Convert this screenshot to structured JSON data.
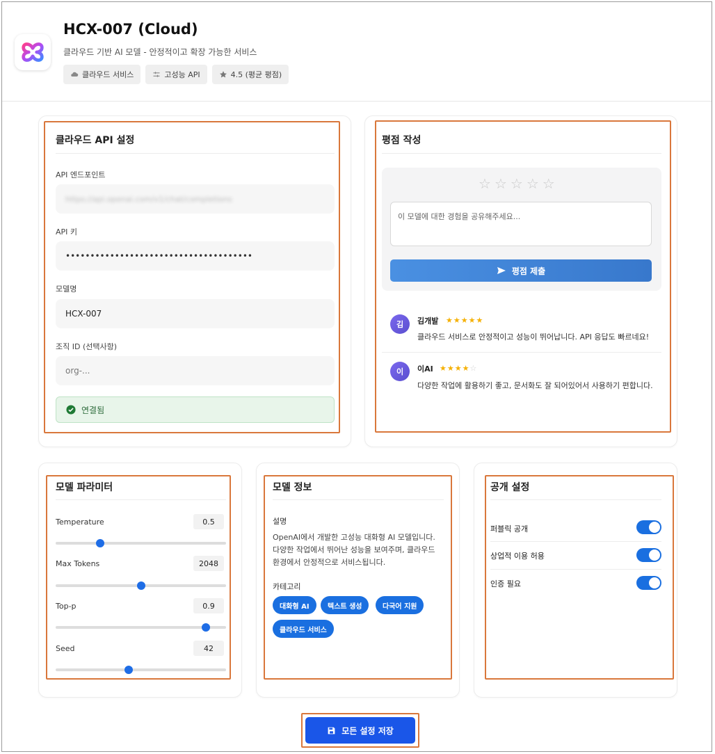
{
  "header": {
    "title": "HCX-007 (Cloud)",
    "subtitle": "클라우드 기반 AI 모델 - 안정적이고 확장 가능한 서비스",
    "badges": [
      {
        "icon": "cloud-icon",
        "label": "클라우드 서비스"
      },
      {
        "icon": "sliders-icon",
        "label": "고성능 API"
      },
      {
        "icon": "star-icon",
        "label": "4.5 (평균 평점)"
      }
    ]
  },
  "api_settings": {
    "title": "클라우드 API 설정",
    "endpoint_label": "API 엔드포인트",
    "endpoint_value": "https://api.openai.com/v1/chat/completions",
    "key_label": "API 키",
    "key_value": "••••••••••••••••••••••••••••••••••••••",
    "model_label": "모델명",
    "model_value": "HCX-007",
    "org_label": "조직 ID (선택사항)",
    "org_placeholder": "org-...",
    "status": "연결됨"
  },
  "rating": {
    "title": "평점 작성",
    "stars": [
      "☆",
      "☆",
      "☆",
      "☆",
      "☆"
    ],
    "textarea_placeholder": "이 모델에 대한 경험을 공유해주세요...",
    "submit_label": "평점 제출",
    "reviews": [
      {
        "avatar": "김",
        "name": "김개발",
        "rating": 5,
        "text": "클라우드 서비스로 안정적이고 성능이 뛰어납니다. API 응답도 빠르네요!"
      },
      {
        "avatar": "이",
        "name": "이AI",
        "rating": 4,
        "text": "다양한 작업에 활용하기 좋고, 문서화도 잘 되어있어서 사용하기 편합니다."
      }
    ]
  },
  "parameters": {
    "title": "모델 파라미터",
    "items": [
      {
        "label": "Temperature",
        "value": "0.5",
        "fraction": 0.26
      },
      {
        "label": "Max Tokens",
        "value": "2048",
        "fraction": 0.5
      },
      {
        "label": "Top-p",
        "value": "0.9",
        "fraction": 0.88
      },
      {
        "label": "Seed",
        "value": "42",
        "fraction": 0.43
      }
    ]
  },
  "model_info": {
    "title": "모델 정보",
    "desc_label": "설명",
    "desc_lines": [
      "OpenAI에서 개발한 고성능 대화형 AI 모델입니다.",
      "다양한 작업에서 뛰어난 성능을 보여주며, 클라우드",
      "환경에서 안정적으로 서비스됩니다."
    ],
    "category_label": "카테고리",
    "categories": [
      "대화형 AI",
      "텍스트 생성",
      "다국어 지원",
      "클라우드 서비스"
    ]
  },
  "visibility": {
    "title": "공개 설정",
    "toggles": [
      {
        "label": "퍼블릭 공개",
        "on": true
      },
      {
        "label": "상업적 이용 허용",
        "on": true
      },
      {
        "label": "인증 필요",
        "on": true
      }
    ]
  },
  "save_label": "모든 설정 저장",
  "colors": {
    "accent": "#1a6fe0",
    "highlight": "#d9773b",
    "success": "#2b6a3a",
    "star": "#f5b000"
  }
}
